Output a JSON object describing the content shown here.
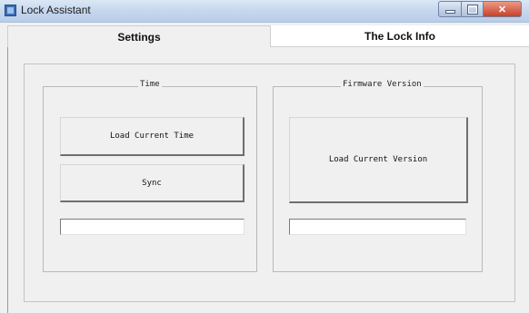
{
  "window": {
    "title": "Lock Assistant"
  },
  "tabs": [
    {
      "label": "Settings",
      "active": true
    },
    {
      "label": "The Lock Info",
      "active": false
    }
  ],
  "time_group": {
    "legend": "Time",
    "load_button": "Load Current Time",
    "sync_button": "Sync",
    "value": ""
  },
  "firmware_group": {
    "legend": "Firmware Version",
    "load_button": "Load Current Version",
    "value": ""
  },
  "icons": {
    "app": "lock-assistant-app-icon",
    "minimize": "minimize-icon",
    "maximize": "maximize-icon",
    "close": "close-icon"
  },
  "colors": {
    "titlebar": "#c6d7ee",
    "close_button": "#c8412a",
    "window_bg": "#f0f0f0"
  }
}
